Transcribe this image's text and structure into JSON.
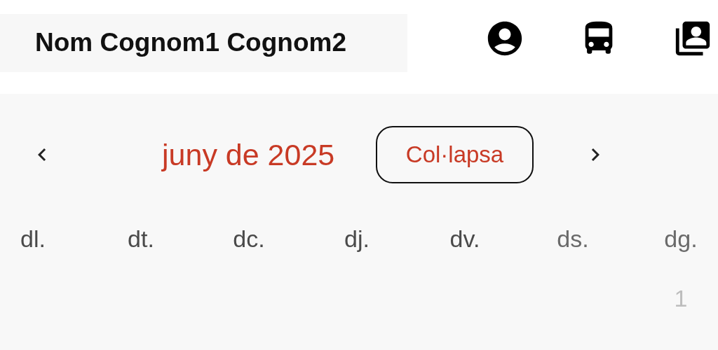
{
  "header": {
    "user_name": "Nom Cognom1 Cognom2"
  },
  "calendar": {
    "month_title": "juny de 2025",
    "collapse_button": "Col·lapsa",
    "weekdays": [
      {
        "label": "dl.",
        "weekend": false
      },
      {
        "label": "dt.",
        "weekend": false
      },
      {
        "label": "dc.",
        "weekend": false
      },
      {
        "label": "dj.",
        "weekend": false
      },
      {
        "label": "dv.",
        "weekend": false
      },
      {
        "label": "ds.",
        "weekend": true
      },
      {
        "label": "dg.",
        "weekend": true
      }
    ],
    "days": [
      {
        "kind": "blank"
      },
      {
        "kind": "blank"
      },
      {
        "kind": "blank"
      },
      {
        "kind": "blank"
      },
      {
        "kind": "blank"
      },
      {
        "kind": "blank"
      },
      {
        "kind": "day",
        "label": "1",
        "muted": true
      }
    ]
  }
}
